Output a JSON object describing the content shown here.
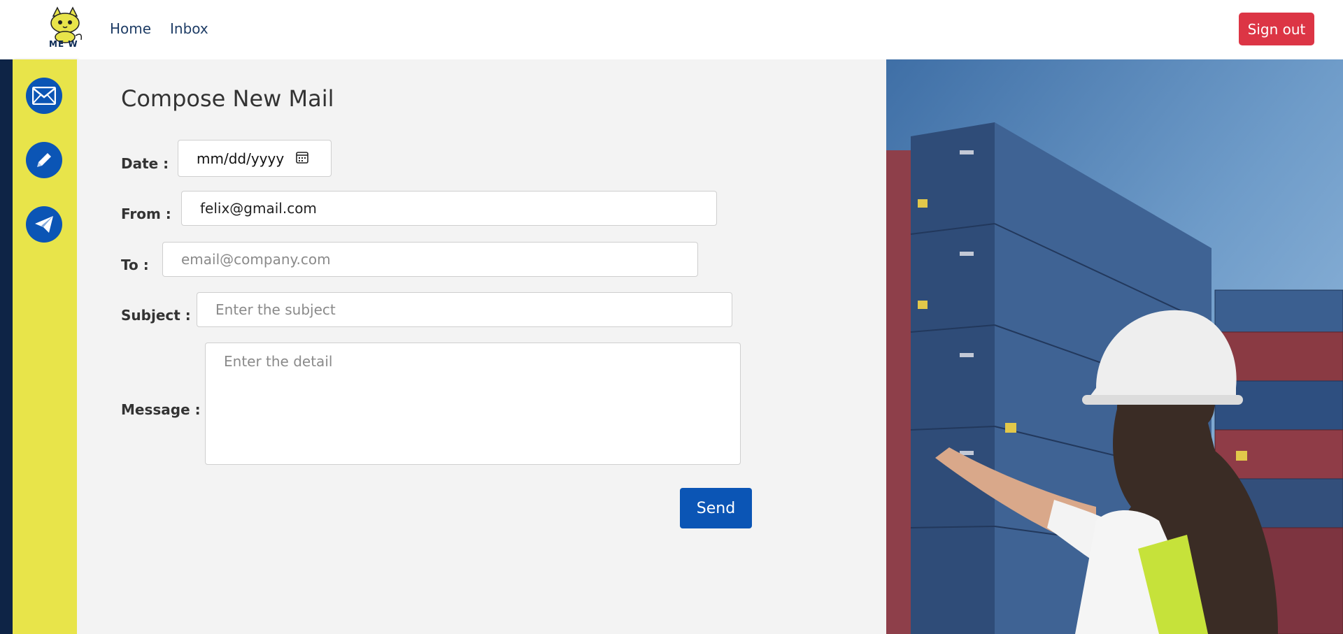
{
  "nav": {
    "logo_text": "ME  W",
    "home_label": "Home",
    "inbox_label": "Inbox",
    "signout_label": "Sign out"
  },
  "sidebar": {
    "items": [
      {
        "icon": "mail-icon"
      },
      {
        "icon": "pencil-icon"
      },
      {
        "icon": "send-icon"
      }
    ]
  },
  "compose": {
    "title": "Compose New Mail",
    "date_label": "Date :",
    "date_value": "mm/dd/yyyy",
    "from_label": "From :",
    "from_value": "felix@gmail.com",
    "to_label": "To :",
    "to_placeholder": "email@company.com",
    "subject_label": "Subject :",
    "subject_placeholder": "Enter the subject",
    "message_label": "Message :",
    "message_placeholder": "Enter the detail",
    "send_label": "Send"
  },
  "colors": {
    "accent": "#0b55b5",
    "danger": "#dc3545",
    "sidebar": "#e8e44a",
    "sidebar_edge": "#0e2446",
    "panel": "#f3f3f3"
  }
}
